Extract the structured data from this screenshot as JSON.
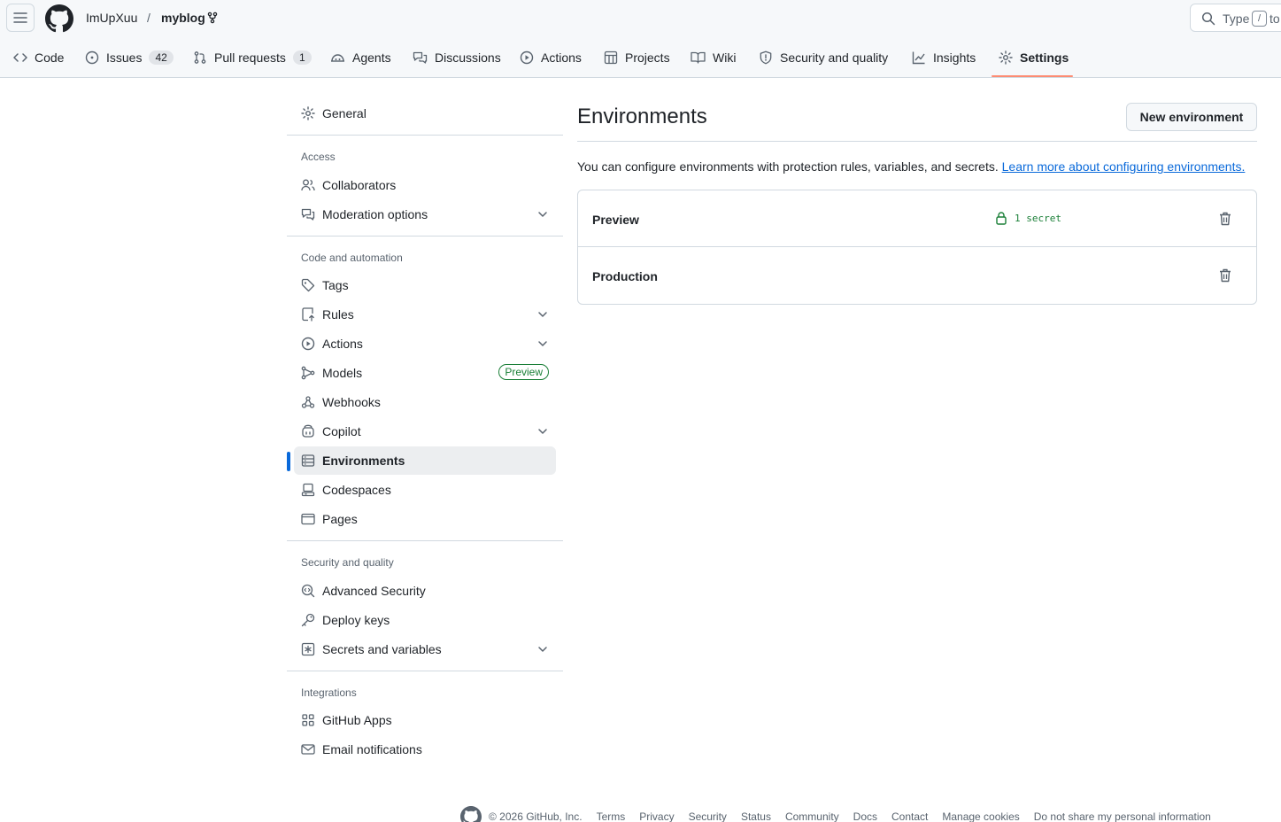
{
  "header": {
    "owner": "ImUpXuu",
    "separator": "/",
    "repo": "myblog",
    "search_placeholder": "Type",
    "search_key": "/",
    "search_suffix": "to"
  },
  "tabs": [
    {
      "label": "Code",
      "icon": "code-icon"
    },
    {
      "label": "Issues",
      "count": "42",
      "icon": "issue-icon"
    },
    {
      "label": "Pull requests",
      "count": "1",
      "icon": "pull-request-icon"
    },
    {
      "label": "Agents",
      "icon": "agents-icon"
    },
    {
      "label": "Discussions",
      "icon": "discussions-icon"
    },
    {
      "label": "Actions",
      "icon": "play-icon"
    },
    {
      "label": "Projects",
      "icon": "table-icon"
    },
    {
      "label": "Wiki",
      "icon": "book-icon"
    },
    {
      "label": "Security and quality",
      "icon": "shield-icon"
    },
    {
      "label": "Insights",
      "icon": "graph-icon"
    },
    {
      "label": "Settings",
      "icon": "gear-icon",
      "selected": true
    }
  ],
  "sidebar": {
    "general": "General",
    "access_heading": "Access",
    "collaborators": "Collaborators",
    "moderation": "Moderation options",
    "code_heading": "Code and automation",
    "tags": "Tags",
    "rules": "Rules",
    "actions": "Actions",
    "models": "Models",
    "models_badge": "Preview",
    "webhooks": "Webhooks",
    "copilot": "Copilot",
    "environments": "Environments",
    "codespaces": "Codespaces",
    "pages": "Pages",
    "security_heading": "Security and quality",
    "advanced_security": "Advanced Security",
    "deploy_keys": "Deploy keys",
    "secrets": "Secrets and variables",
    "integrations_heading": "Integrations",
    "github_apps": "GitHub Apps",
    "email_notifications": "Email notifications"
  },
  "main": {
    "title": "Environments",
    "new_button": "New environment",
    "description": "You can configure environments with protection rules, variables, and secrets.",
    "learn_more": "Learn more about configuring environments.",
    "environments": [
      {
        "name": "Preview",
        "secret": "1 secret"
      },
      {
        "name": "Production"
      }
    ]
  },
  "footer": {
    "copyright": "© 2026 GitHub, Inc.",
    "links": [
      "Terms",
      "Privacy",
      "Security",
      "Status",
      "Community",
      "Docs",
      "Contact",
      "Manage cookies",
      "Do not share my personal information"
    ]
  },
  "colors": {
    "accent": "#0969da",
    "success": "#1a7f37",
    "selected_underline": "#fd8c73"
  }
}
